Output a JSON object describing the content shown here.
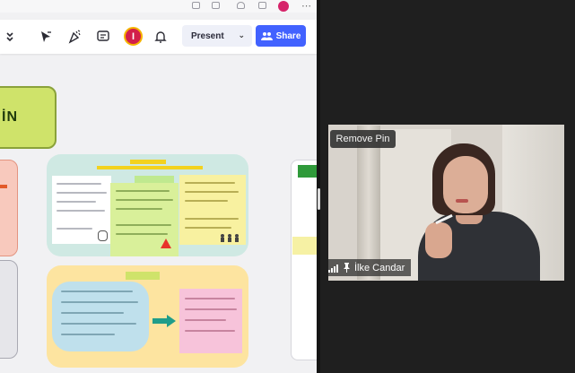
{
  "toolbar": {
    "avatar_initial": "I",
    "present_label": "Present",
    "present_caret": "⌄",
    "share_label": "Share",
    "share_icon": "people-icon"
  },
  "board": {
    "title_fragment": "İN"
  },
  "video": {
    "remove_pin_label": "Remove Pin",
    "participant_name": "İlke Candar",
    "icons": [
      "signal-bars-icon",
      "pin-icon"
    ]
  },
  "colors": {
    "share_button": "#4262ff",
    "avatar": "#d21f4b",
    "title_block": "#cfe36a",
    "video_background": "#1f1f1f"
  }
}
